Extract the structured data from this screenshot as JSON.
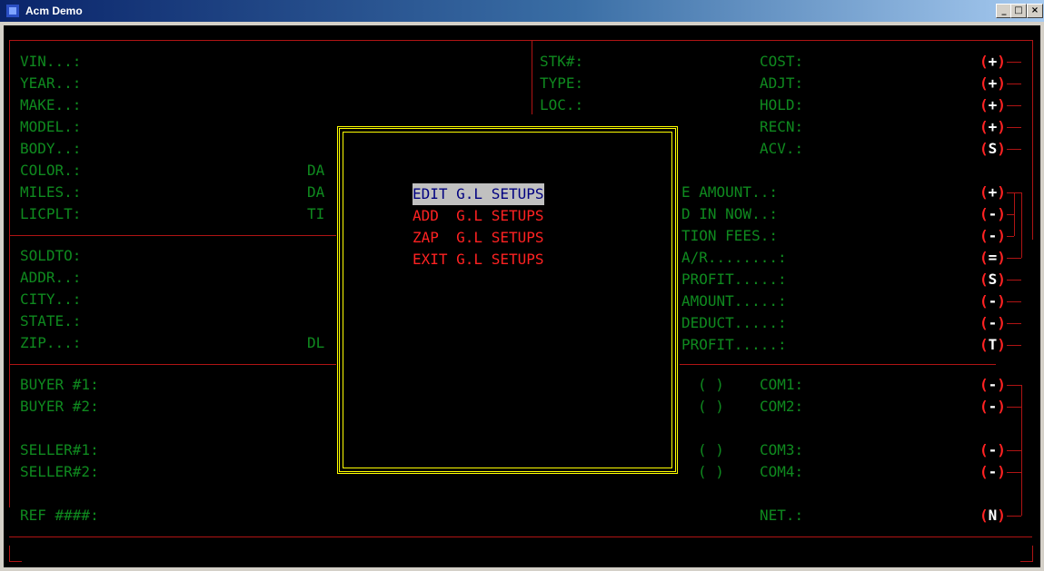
{
  "window": {
    "title": "Acm Demo",
    "buttons": [
      "_",
      "□",
      "×"
    ]
  },
  "left_fields": {
    "vin": "VIN...:",
    "year": "YEAR..:",
    "make": "MAKE..:",
    "model": "MODEL.:",
    "body": "BODY..:",
    "color": "COLOR.:",
    "miles": "MILES.:",
    "licplt": "LICPLT:",
    "soldto": "SOLDTO:",
    "addr": "ADDR..:",
    "city": "CITY..:",
    "state": "STATE.:",
    "zip": "ZIP...:",
    "buyer1": "BUYER #1:",
    "buyer2": "BUYER #2:",
    "seller1": "SELLER#1:",
    "seller2": "SELLER#2:",
    "ref": "REF ####:"
  },
  "partial_labels": {
    "da1": "DA",
    "da2": "DA",
    "ti": "TI",
    "dl": "DL"
  },
  "stock_fields": {
    "stk": "STK#:",
    "type": "TYPE:",
    "loc": "LOC.:"
  },
  "cost_fields": {
    "cost": "COST:",
    "adjt": "ADJT:",
    "hold": "HOLD:",
    "recn": "RECN:",
    "acv": "ACV.:",
    "e_amount": "E AMOUNT..:",
    "d_in_now": "D IN NOW..:",
    "tion_fees": "TION FEES.:",
    "ar": "A/R........:",
    "profit1": "PROFIT.....:",
    "amount": "AMOUNT.....:",
    "deduct": "DEDUCT.....:",
    "profit2": "PROFIT.....:",
    "check1": "( )",
    "check2": "( )",
    "check3": "( )",
    "check4": "( )",
    "com1": "COM1:",
    "com2": "COM2:",
    "com3": "COM3:",
    "com4": "COM4:",
    "net": "NET.:"
  },
  "signs": [
    "+",
    "+",
    "+",
    "+",
    "S",
    "+",
    "-",
    "-",
    "=",
    "S",
    "-",
    "-",
    "T",
    "-",
    "-",
    "-",
    "-",
    "N"
  ],
  "menu": {
    "items": [
      "EDIT G.L SETUPS",
      "ADD  G.L SETUPS",
      "ZAP  G.L SETUPS",
      "EXIT G.L SETUPS"
    ],
    "selected_index": 0
  },
  "colors": {
    "label": "#0f8a1f",
    "border": "#b01414",
    "popup_border": "#ffff00",
    "menu_text": "#ff2222"
  }
}
